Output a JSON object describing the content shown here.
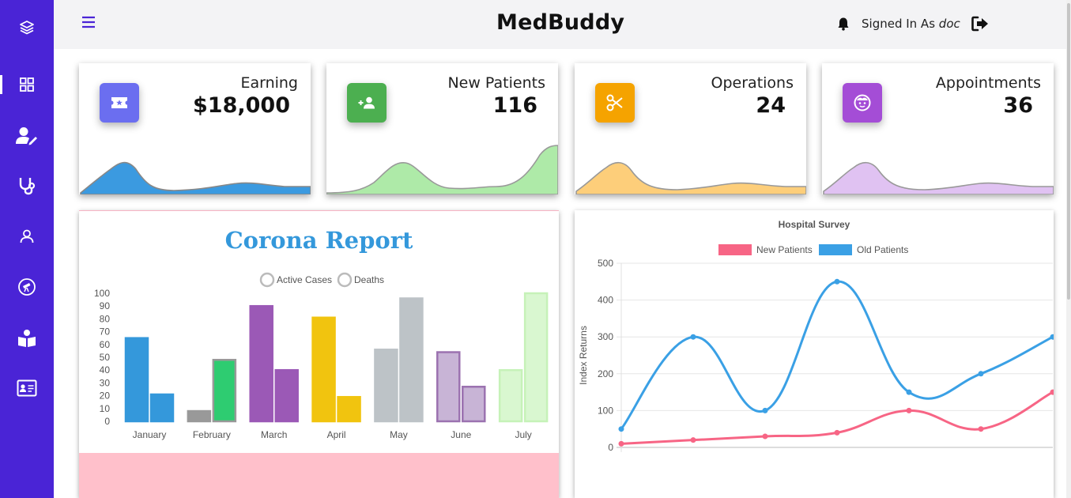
{
  "app": {
    "brand": "MedBuddy",
    "signed_in_label": "Signed In As",
    "user": "doc"
  },
  "sidebar": {
    "items": [
      {
        "icon": "layers-icon"
      },
      {
        "icon": "dashboard-icon",
        "active": true
      },
      {
        "icon": "user-edit-icon"
      },
      {
        "icon": "stethoscope-icon"
      },
      {
        "icon": "user-icon"
      },
      {
        "icon": "telescope-icon"
      },
      {
        "icon": "reader-icon"
      },
      {
        "icon": "id-card-icon"
      }
    ],
    "color": "#4a24d6"
  },
  "stats": [
    {
      "title": "Earning",
      "value": "$18,000",
      "icon": "ticket-icon",
      "color": "#6b6ef0",
      "wave": "#3b9ae0",
      "wave_stroke": "#888888"
    },
    {
      "title": "New Patients",
      "value": "116",
      "icon": "add-user-icon",
      "color": "#4caf50",
      "wave": "#aeeaa8",
      "wave_stroke": "#999999"
    },
    {
      "title": "Operations",
      "value": "24",
      "icon": "scissors-icon",
      "color": "#f5a300",
      "wave": "#fdce7a",
      "wave_stroke": "#999999"
    },
    {
      "title": "Appointments",
      "value": "36",
      "icon": "baby-face-icon",
      "color": "#a44dd6",
      "wave": "#e0c2f2",
      "wave_stroke": "#999999"
    }
  ],
  "corona_report": {
    "title": "Corona Report",
    "footer_color": "#ffc0cb"
  },
  "chart_data": [
    {
      "type": "bar",
      "title": "Corona Report",
      "categories": [
        "January",
        "February",
        "March",
        "April",
        "May",
        "June",
        "July"
      ],
      "series": [
        {
          "name": "Active Cases",
          "values": [
            65,
            8,
            90,
            81,
            56,
            54,
            40
          ]
        },
        {
          "name": "Deaths",
          "values": [
            21,
            48,
            40,
            19,
            96,
            27,
            100
          ]
        }
      ],
      "bar_colors": [
        [
          "#3498db",
          "#3498db"
        ],
        [
          "#999999",
          "#2ecc71"
        ],
        [
          "#9b59b6",
          "#9b59b6"
        ],
        [
          "#f1c40f",
          "#f1c40f"
        ],
        [
          "#bdc3c7",
          "#bdc3c7"
        ],
        [
          "#c8b4d6",
          "#c8b4d6"
        ],
        [
          "#d9f7d0",
          "#d9f7d0"
        ]
      ],
      "bar_borders": [
        [
          "#3498db",
          "#3498db"
        ],
        [
          "#999999",
          "#999999"
        ],
        [
          "#9b59b6",
          "#9b59b6"
        ],
        [
          "#f1c40f",
          "#f1c40f"
        ],
        [
          "#bdc3c7",
          "#bdc3c7"
        ],
        [
          "#9b72b0",
          "#9b72b0"
        ],
        [
          "#c6f2b8",
          "#c6f2b8"
        ]
      ],
      "yticks": [
        0,
        10,
        20,
        30,
        40,
        50,
        60,
        70,
        80,
        90,
        100
      ],
      "ylim": [
        0,
        100
      ],
      "legend": "top"
    },
    {
      "type": "line",
      "title": "Hospital Survey",
      "ylabel": "Index Returns",
      "x_points": 7,
      "series": [
        {
          "name": "New Patients",
          "values": [
            10,
            20,
            30,
            40,
            100,
            50,
            150
          ],
          "color": "#f76585"
        },
        {
          "name": "Old Patients",
          "values": [
            50,
            300,
            100,
            450,
            150,
            200,
            300
          ],
          "color": "#3aa0e5"
        }
      ],
      "yticks": [
        0,
        100,
        200,
        300,
        400,
        500
      ],
      "ylim": [
        0,
        500
      ],
      "legend": "top"
    }
  ]
}
